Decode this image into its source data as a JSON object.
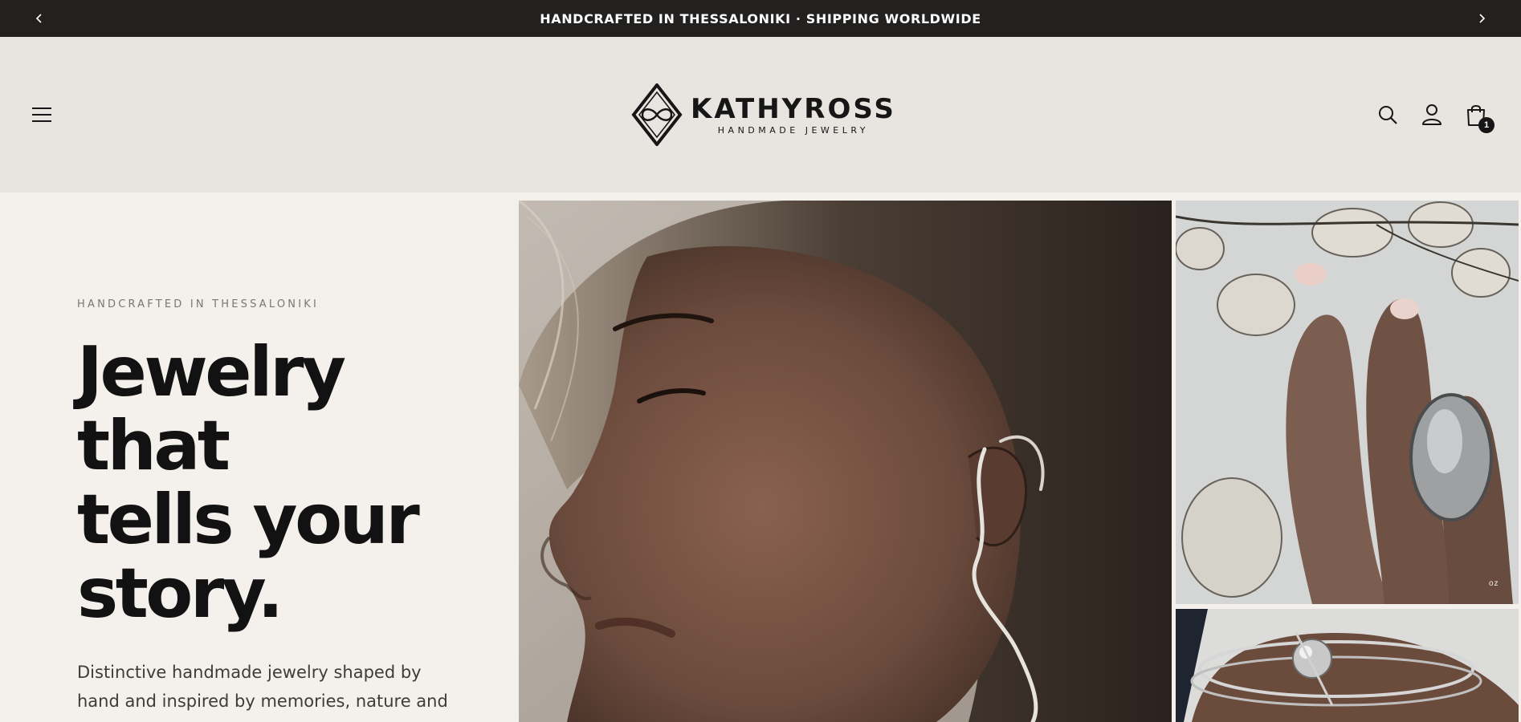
{
  "announcement": {
    "text": "HANDCRAFTED IN THESSALONIKI · SHIPPING WORLDWIDE",
    "prev_icon": "chevron-left-icon",
    "next_icon": "chevron-right-icon"
  },
  "header": {
    "menu_icon": "hamburger-menu-icon",
    "logo": {
      "name": "KATHYROSS",
      "tagline": "HANDMADE JEWELRY"
    },
    "icons": [
      "search-icon",
      "account-icon",
      "shopping-bag-icon"
    ],
    "cart_count": "1"
  },
  "hero": {
    "eyebrow": "HANDCRAFTED IN THESSALONIKI",
    "title_lines": [
      "Jewelry",
      "that",
      "tells your",
      "story."
    ],
    "description": "Distinctive handmade jewelry shaped by hand and inspired by memories, nature and"
  },
  "gallery": {
    "ring_photo_caption": "oz"
  },
  "colors": {
    "announcement_bg": "#232120",
    "header_bg": "#e8e4df",
    "page_bg": "#f4f1ed",
    "text": "#121212"
  }
}
